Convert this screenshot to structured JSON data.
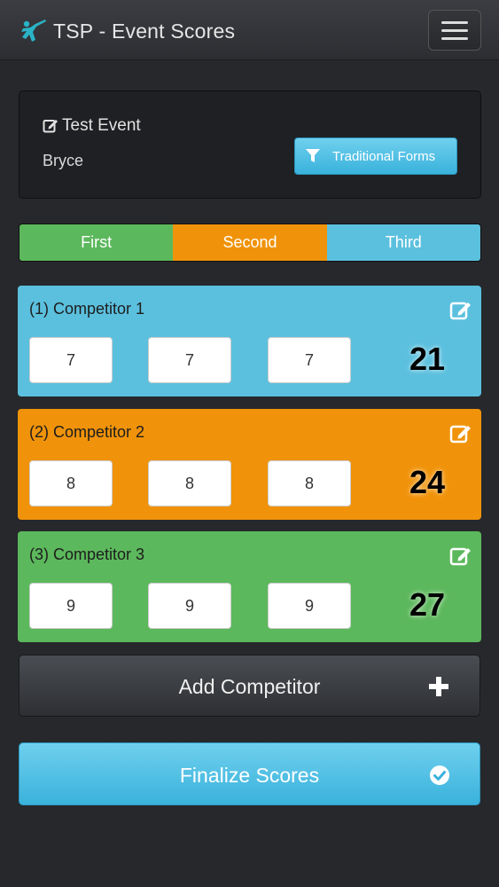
{
  "navbar": {
    "title": "TSP - Event Scores",
    "logo_icon": "martial-arts-kick-icon",
    "menu_icon": "hamburger-icon"
  },
  "event": {
    "name": "Test Event",
    "user": "Bryce",
    "filter_label": "Traditional Forms"
  },
  "placement": {
    "first": "First",
    "second": "Second",
    "third": "Third"
  },
  "competitors": [
    {
      "label": "(1) Competitor 1",
      "scores": [
        "7",
        "7",
        "7"
      ],
      "total": "21",
      "color": "#5bc0de"
    },
    {
      "label": "(2) Competitor 2",
      "scores": [
        "8",
        "8",
        "8"
      ],
      "total": "24",
      "color": "#f0930a"
    },
    {
      "label": "(3) Competitor 3",
      "scores": [
        "9",
        "9",
        "9"
      ],
      "total": "27",
      "color": "#5cb85c"
    }
  ],
  "actions": {
    "add_label": "Add Competitor",
    "finalize_label": "Finalize Scores"
  },
  "colors": {
    "accent_blue": "#5bc0de",
    "accent_orange": "#f0930a",
    "accent_green": "#5cb85c",
    "background": "#26282c"
  }
}
